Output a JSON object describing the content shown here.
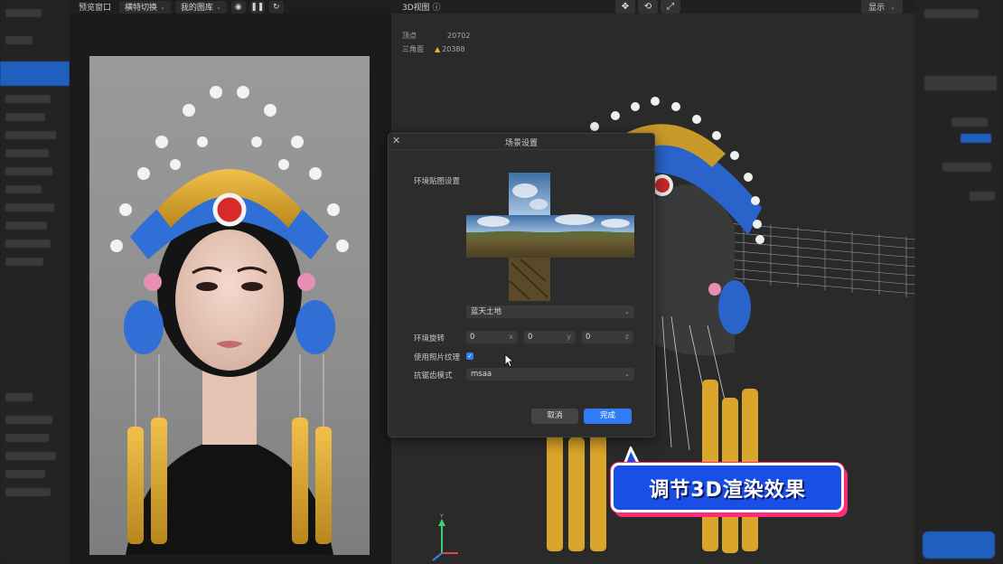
{
  "preview": {
    "title": "预览窗口",
    "switch_label": "横特切换",
    "library_label": "我的图库",
    "icons": [
      "camera-icon",
      "pause-icon",
      "refresh-icon"
    ]
  },
  "view3d": {
    "title": "3D视图",
    "display_label": "显示",
    "tools": [
      "move-icon",
      "rotate-icon",
      "fullscreen-icon"
    ],
    "stats": {
      "vertices_label": "顶点",
      "vertices_value": "20702",
      "triangles_label": "三角面",
      "triangles_value": "20388"
    }
  },
  "dialog": {
    "title": "场景设置",
    "env_map_label": "环境贴图设置",
    "env_select_value": "蓝天土地",
    "rotation_label": "环境旋转",
    "rotation": [
      {
        "value": "0",
        "axis": "x"
      },
      {
        "value": "0",
        "axis": "y"
      },
      {
        "value": "0",
        "axis": "z"
      }
    ],
    "photo_texture_label": "使用照片纹理",
    "photo_texture_checked": true,
    "antialias_label": "抗锯齿模式",
    "antialias_value": "msaa",
    "cancel_label": "取消",
    "done_label": "完成"
  },
  "caption": {
    "text": "调节3D渲染效果"
  },
  "colors": {
    "accent_blue": "#2f7cf6",
    "caption_bg": "#1a4fe6",
    "caption_shadow": "#ff2a7a",
    "warning": "#f0b429"
  }
}
